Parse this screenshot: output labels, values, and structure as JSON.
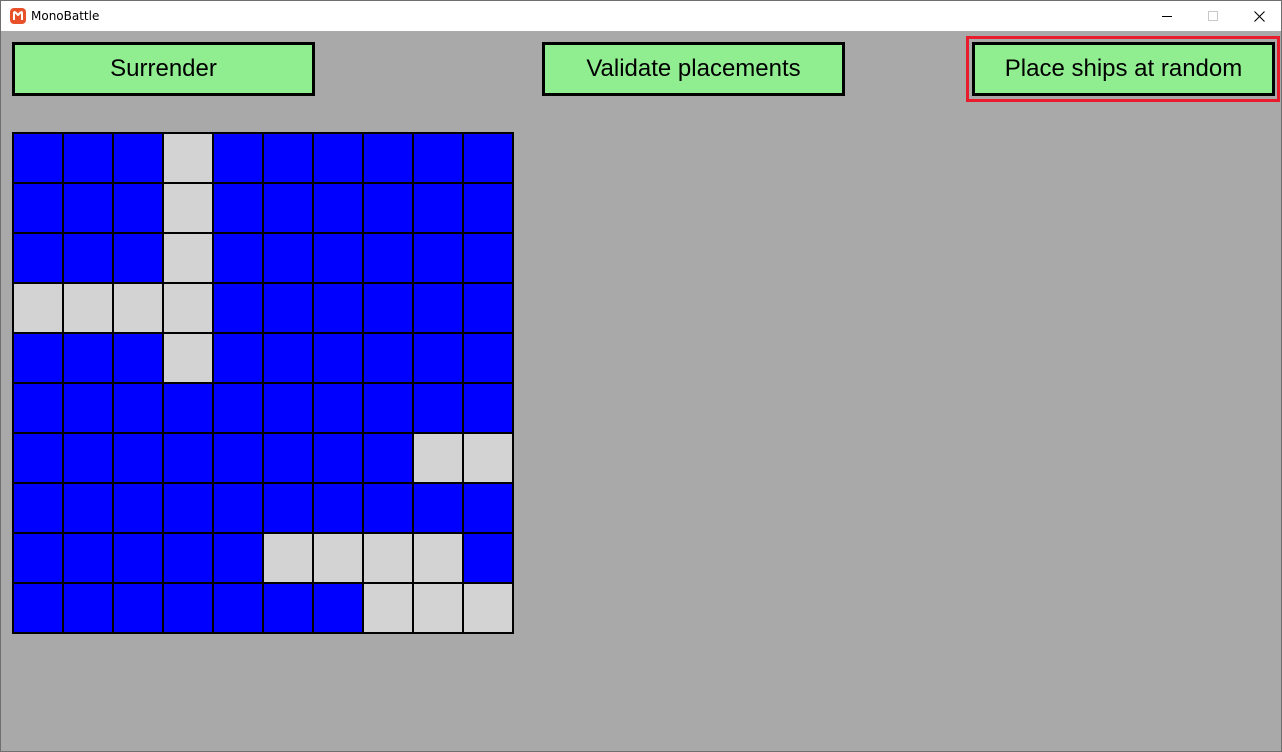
{
  "window": {
    "title": "MonoBattle",
    "controls": [
      "minimize",
      "maximize",
      "close"
    ]
  },
  "toolbar": {
    "surrender_label": "Surrender",
    "validate_label": "Validate placements",
    "random_label": "Place ships at random",
    "highlighted_button": "random"
  },
  "colors": {
    "water": "#0000ff",
    "ship": "#d3d3d3",
    "button": "#90ee90",
    "background": "#a9a9a9",
    "highlight": "#e81c2c"
  },
  "board": {
    "size": 10,
    "rows": [
      "...S......",
      "...S......",
      "...S......",
      "SSSS......",
      "...S......",
      "..........",
      "........SS",
      "..........",
      ".....SSSS.",
      ".......SSS"
    ]
  }
}
